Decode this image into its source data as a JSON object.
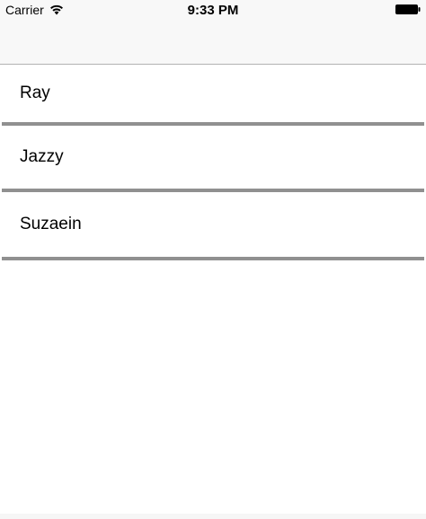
{
  "status_bar": {
    "carrier": "Carrier",
    "time": "9:33 PM",
    "icons": [
      "wifi-icon",
      "battery-icon"
    ]
  },
  "list": {
    "items": [
      {
        "label": "Ray"
      },
      {
        "label": "Jazzy"
      },
      {
        "label": "Suzaein"
      }
    ]
  },
  "colors": {
    "separator": "#909090",
    "nav_background": "#f8f8f8",
    "nav_border": "#b2b2b2"
  }
}
